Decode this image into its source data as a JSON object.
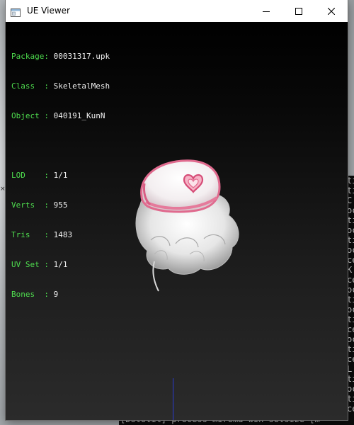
{
  "window": {
    "title": "UE Viewer"
  },
  "info": {
    "package_label": "Package: ",
    "package_value": "00031317.upk",
    "class_label": "Class  : ",
    "class_value": "SkeletalMesh",
    "object_label": "Object : ",
    "object_value": "040191_KunN",
    "lod_label": "LOD    : ",
    "lod_value": "1/1",
    "verts_label": "Verts  : ",
    "verts_value": "955",
    "tris_label": "Tris   : ",
    "tris_value": "1483",
    "uvset_label": "UV Set : ",
    "uvset_value": "1/1",
    "bones_label": "Bones  : ",
    "bones_value": "9"
  },
  "console": {
    "bottom_line": "[Dstotil] process  mirema wih setsize  [m"
  },
  "colors": {
    "label_green": "#4edc4e",
    "value_white": "#f0f0f0",
    "axis_blue": "#2a3bd0",
    "mesh_pink": "#e87a9a"
  }
}
